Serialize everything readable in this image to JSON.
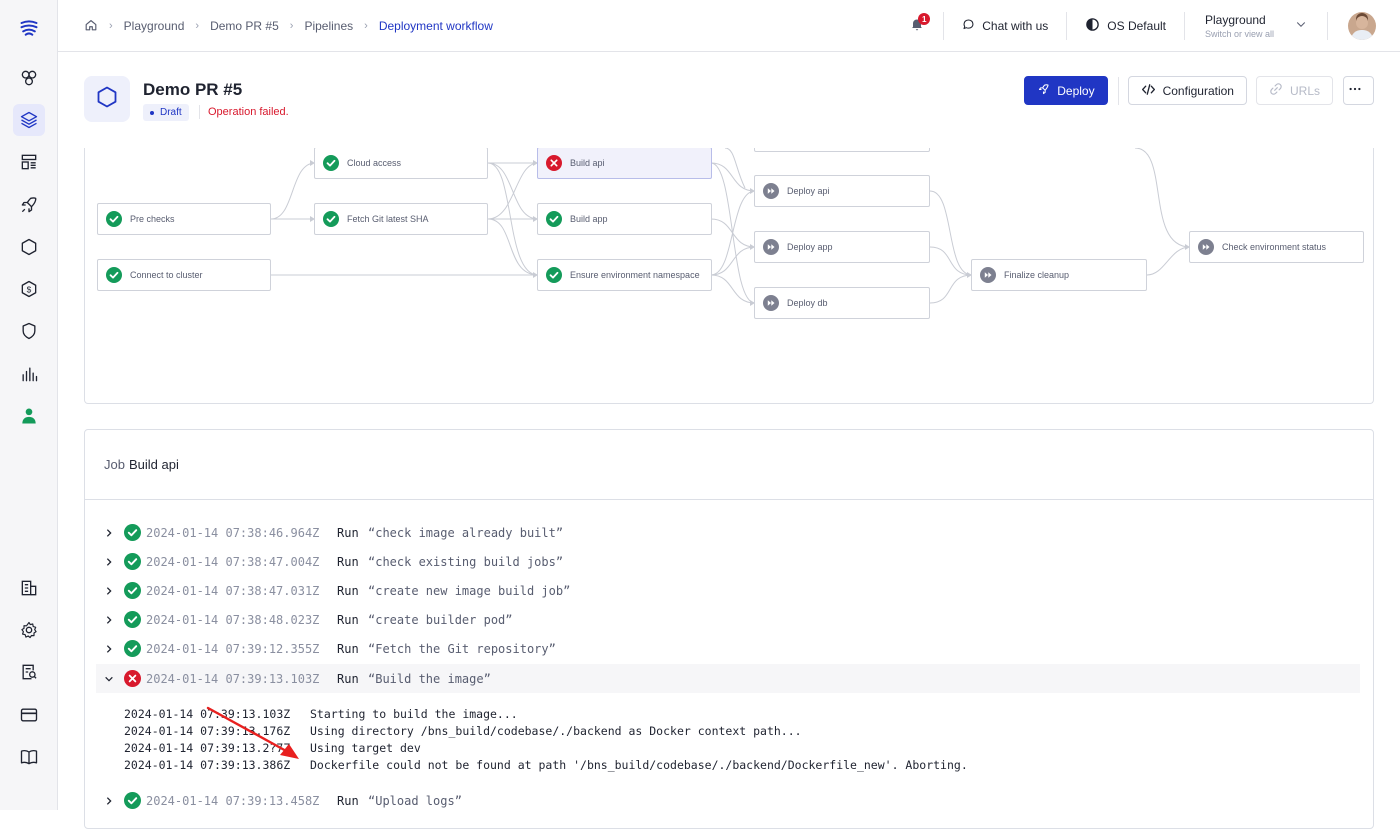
{
  "colors": {
    "primary": "#2036c4",
    "success": "#149b5a",
    "error": "#d8192d",
    "pending": "#7d8090"
  },
  "sidebar": {
    "items": [
      {
        "name": "logo",
        "icon": "logo-icon"
      },
      {
        "name": "services",
        "icon": "services-icon"
      },
      {
        "name": "environments",
        "icon": "layers-icon",
        "active": true
      },
      {
        "name": "templates",
        "icon": "templates-icon"
      },
      {
        "name": "deployments",
        "icon": "rocket-icon"
      },
      {
        "name": "clusters",
        "icon": "hexagon-icon"
      },
      {
        "name": "billing",
        "icon": "dollar-icon"
      },
      {
        "name": "security",
        "icon": "shield-icon"
      },
      {
        "name": "analytics",
        "icon": "chart-icon"
      },
      {
        "name": "members",
        "icon": "users-icon"
      },
      {
        "name": "organization",
        "icon": "building-icon"
      },
      {
        "name": "settings",
        "icon": "gear-icon"
      },
      {
        "name": "audit",
        "icon": "audit-icon"
      },
      {
        "name": "payment",
        "icon": "credit-card-icon"
      },
      {
        "name": "docs",
        "icon": "book-icon"
      }
    ]
  },
  "topbar": {
    "breadcrumbs": [
      "Playground",
      "Demo PR #5",
      "Pipelines",
      "Deployment workflow"
    ],
    "notification_count": "1",
    "chat_label": "Chat with us",
    "theme_label": "OS Default",
    "org_name": "Playground",
    "org_sub": "Switch or view all"
  },
  "header": {
    "title": "Demo PR #5",
    "status_badge": "Draft",
    "status_message": "Operation failed.",
    "deploy_label": "Deploy",
    "configuration_label": "Configuration",
    "urls_label": "URLs"
  },
  "pipeline": {
    "nodes": [
      {
        "id": "pre-checks",
        "label": "Pre checks",
        "status": "success"
      },
      {
        "id": "connect",
        "label": "Connect to cluster",
        "status": "success"
      },
      {
        "id": "cloud-access",
        "label": "Cloud access",
        "status": "success"
      },
      {
        "id": "fetch-sha",
        "label": "Fetch Git latest SHA",
        "status": "success"
      },
      {
        "id": "build-api",
        "label": "Build api",
        "status": "error",
        "selected": true
      },
      {
        "id": "build-app",
        "label": "Build app",
        "status": "success"
      },
      {
        "id": "ensure-ns",
        "label": "Ensure environment namespace",
        "status": "success"
      },
      {
        "id": "deploy-api",
        "label": "Deploy api",
        "status": "pending"
      },
      {
        "id": "deploy-app",
        "label": "Deploy app",
        "status": "pending"
      },
      {
        "id": "deploy-db",
        "label": "Deploy db",
        "status": "pending"
      },
      {
        "id": "finalize",
        "label": "Finalize cleanup",
        "status": "pending"
      },
      {
        "id": "check-status",
        "label": "Check environment status",
        "status": "pending"
      }
    ]
  },
  "job": {
    "prefix": "Job",
    "name": "Build api",
    "run_label": "Run",
    "steps": [
      {
        "ts": "2024-01-14 07:38:46.964Z",
        "cmd": "“check image already built”",
        "status": "success"
      },
      {
        "ts": "2024-01-14 07:38:47.004Z",
        "cmd": "“check existing build jobs”",
        "status": "success"
      },
      {
        "ts": "2024-01-14 07:38:47.031Z",
        "cmd": "“create new image build job”",
        "status": "success"
      },
      {
        "ts": "2024-01-14 07:38:48.023Z",
        "cmd": "“create builder pod”",
        "status": "success"
      },
      {
        "ts": "2024-01-14 07:39:12.355Z",
        "cmd": "“Fetch the Git repository”",
        "status": "success"
      },
      {
        "ts": "2024-01-14 07:39:13.103Z",
        "cmd": "“Build the image”",
        "status": "error",
        "expanded": true
      },
      {
        "ts": "2024-01-14 07:39:13.458Z",
        "cmd": "“Upload logs”",
        "status": "success"
      }
    ],
    "output": [
      {
        "ts": "2024-01-14 07:39:13.103Z",
        "msg": "Starting to build the image..."
      },
      {
        "ts": "2024-01-14 07:39:13.176Z",
        "msg": "Using directory /bns_build/codebase/./backend as Docker context path..."
      },
      {
        "ts": "2024-01-14 07:39:13.2?7Z",
        "msg": "Using target dev"
      },
      {
        "ts": "2024-01-14 07:39:13.386Z",
        "msg": "Dockerfile could not be found at path '/bns_build/codebase/./backend/Dockerfile_new'. Aborting."
      }
    ]
  }
}
